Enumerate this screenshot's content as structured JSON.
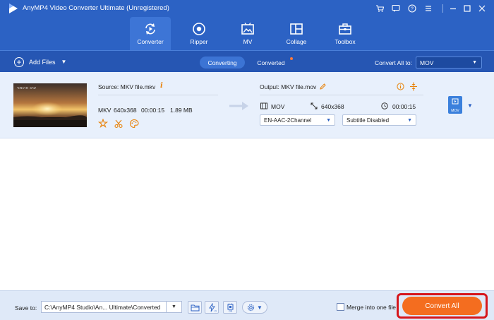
{
  "app": {
    "title": "AnyMP4 Video Converter Ultimate (Unregistered)",
    "logo": "play-logo-icon"
  },
  "window_controls": [
    "cart-icon",
    "chat-icon",
    "help-icon",
    "menu-icon",
    "minimize-icon",
    "maximize-icon",
    "close-icon"
  ],
  "nav": {
    "tabs": [
      {
        "label": "Converter",
        "icon": "converter-icon",
        "active": true
      },
      {
        "label": "Ripper",
        "icon": "ripper-icon",
        "active": false
      },
      {
        "label": "MV",
        "icon": "mv-icon",
        "active": false
      },
      {
        "label": "Collage",
        "icon": "collage-icon",
        "active": false
      },
      {
        "label": "Toolbox",
        "icon": "toolbox-icon",
        "active": false
      }
    ]
  },
  "toolbar": {
    "add_files": "Add Files",
    "segments": [
      "Converting",
      "Converted"
    ],
    "convert_all_to_label": "Convert All to:",
    "convert_all_to_value": "MOV"
  },
  "file": {
    "thumb_text": "ערב ארגמני",
    "source": "Source: MKV file.mkv",
    "src_format": "MKV",
    "src_resolution": "640x368",
    "src_duration": "00:00:15",
    "src_size": "1.89 MB",
    "output": "Output: MKV file.mov",
    "out_format": "MOV",
    "out_resolution": "640x368",
    "out_duration": "00:00:15",
    "audio_track": "EN-AAC-2Channel",
    "subtitle": "Subtitle Disabled",
    "format_badge": "MOV"
  },
  "bottom": {
    "save_to_label": "Save to:",
    "save_path": "C:\\AnyMP4 Studio\\An... Ultimate\\Converted",
    "merge_label": "Merge into one file",
    "convert_all_button": "Convert All"
  },
  "colors": {
    "header": "#2c62c4",
    "toolbar": "#2656b3",
    "file_row": "#e8f0fc",
    "accent_orange": "#f46d1f",
    "highlight_red": "#d6161c"
  }
}
